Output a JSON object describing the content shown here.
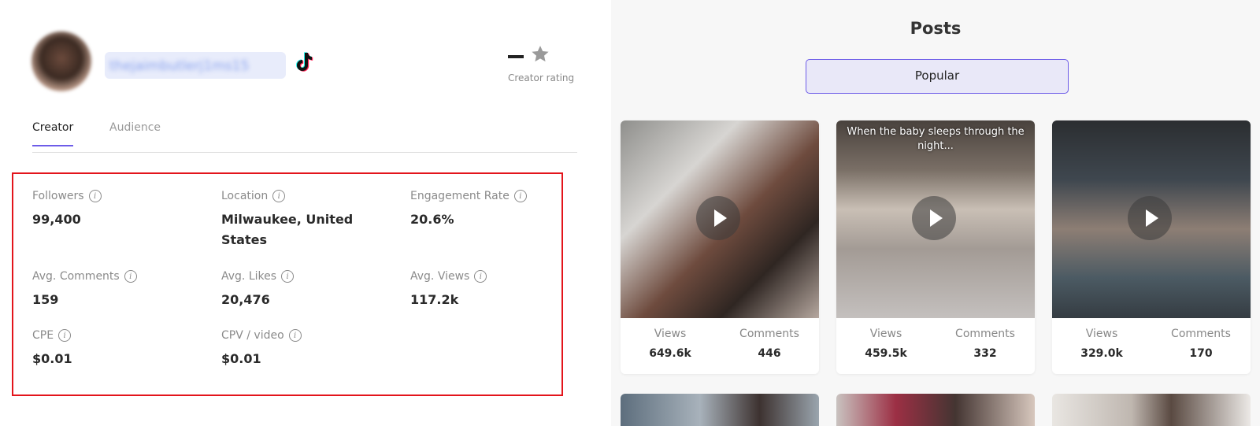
{
  "profile": {
    "username": "thejaimbutlerj1ms15",
    "platform_icon": "tiktok-icon",
    "rating_value": "–",
    "rating_label": "Creator rating"
  },
  "tabs": [
    "Creator",
    "Audience"
  ],
  "stats": [
    {
      "label": "Followers",
      "value": "99,400"
    },
    {
      "label": "Location",
      "value": "Milwaukee, United States"
    },
    {
      "label": "Engagement Rate",
      "value": "20.6%"
    },
    {
      "label": "Avg. Comments",
      "value": "159"
    },
    {
      "label": "Avg. Likes",
      "value": "20,476"
    },
    {
      "label": "Avg. Views",
      "value": "117.2k"
    },
    {
      "label": "CPE",
      "value": "$0.01"
    },
    {
      "label": "CPV / video",
      "value": "$0.01"
    }
  ],
  "posts": {
    "title": "Posts",
    "filter": "Popular",
    "items": [
      {
        "caption": "",
        "views_label": "Views",
        "views": "649.6k",
        "comments_label": "Comments",
        "comments": "446"
      },
      {
        "caption": "When the baby sleeps through the night...",
        "views_label": "Views",
        "views": "459.5k",
        "comments_label": "Comments",
        "comments": "332"
      },
      {
        "caption": "",
        "views_label": "Views",
        "views": "329.0k",
        "comments_label": "Comments",
        "comments": "170"
      }
    ]
  },
  "colors": {
    "accent": "#6d5ce8",
    "highlight_border": "#e3141b"
  }
}
